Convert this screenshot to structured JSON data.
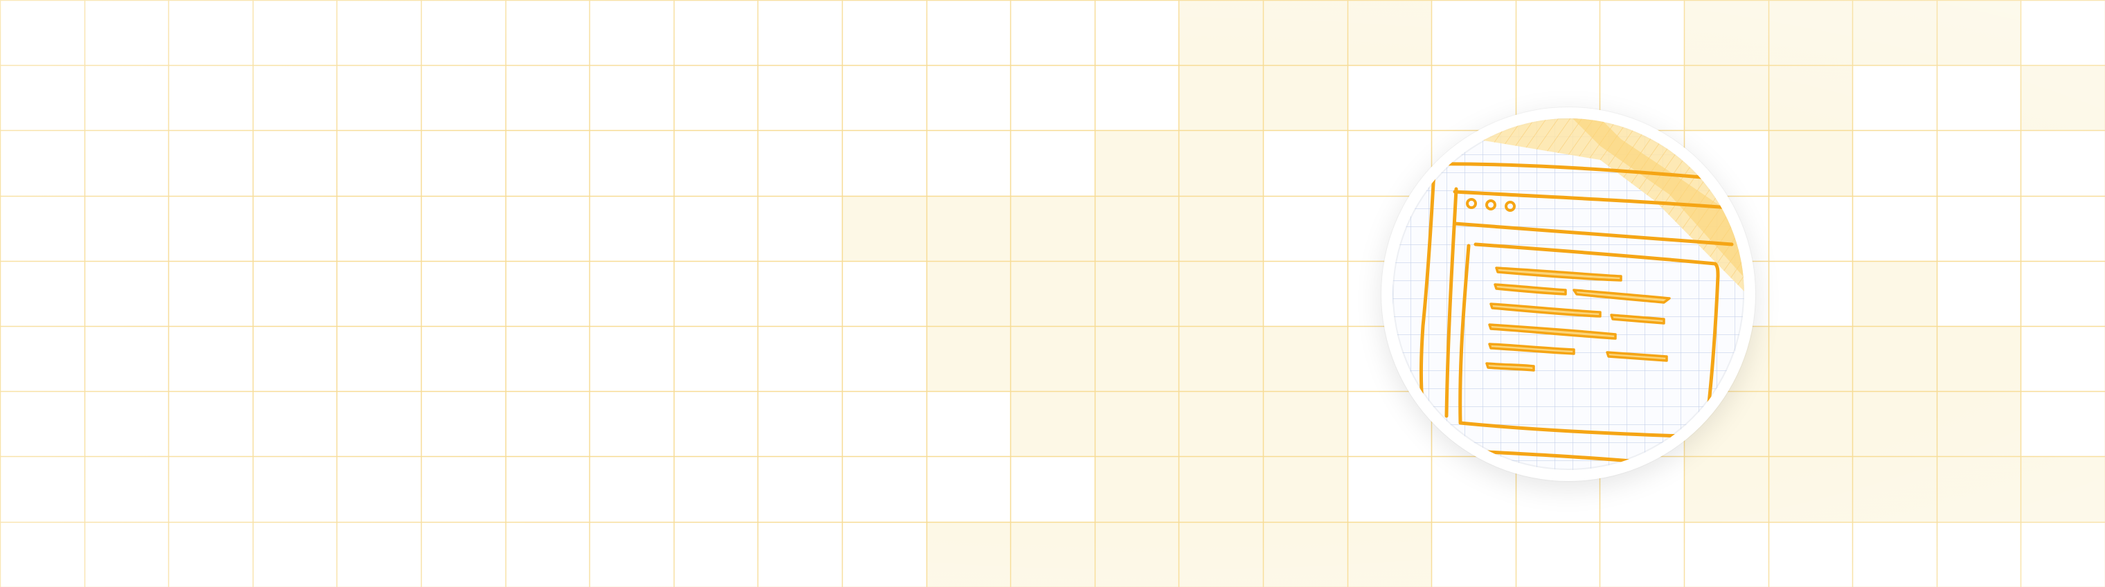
{
  "background": {
    "type": "grid",
    "line_color": "#f7dc95",
    "fill_color": "#fdf8e6",
    "highlighted_cells": [
      [
        14,
        0
      ],
      [
        15,
        0
      ],
      [
        16,
        0
      ],
      [
        20,
        0
      ],
      [
        21,
        0
      ],
      [
        22,
        0
      ],
      [
        23,
        0
      ],
      [
        14,
        1
      ],
      [
        15,
        1
      ],
      [
        20,
        1
      ],
      [
        21,
        1
      ],
      [
        24,
        1
      ],
      [
        13,
        2
      ],
      [
        14,
        2
      ],
      [
        21,
        2
      ],
      [
        10,
        3
      ],
      [
        11,
        3
      ],
      [
        12,
        3
      ],
      [
        13,
        3
      ],
      [
        14,
        3
      ],
      [
        11,
        4
      ],
      [
        12,
        4
      ],
      [
        13,
        4
      ],
      [
        14,
        4
      ],
      [
        22,
        4
      ],
      [
        11,
        5
      ],
      [
        12,
        5
      ],
      [
        13,
        5
      ],
      [
        14,
        5
      ],
      [
        15,
        5
      ],
      [
        20,
        5
      ],
      [
        21,
        5
      ],
      [
        22,
        5
      ],
      [
        23,
        5
      ],
      [
        12,
        6
      ],
      [
        13,
        6
      ],
      [
        14,
        6
      ],
      [
        15,
        6
      ],
      [
        20,
        6
      ],
      [
        21,
        6
      ],
      [
        22,
        6
      ],
      [
        23,
        6
      ],
      [
        13,
        7
      ],
      [
        14,
        7
      ],
      [
        15,
        7
      ],
      [
        20,
        7
      ],
      [
        21,
        7
      ],
      [
        22,
        7
      ],
      [
        23,
        7
      ],
      [
        24,
        7
      ],
      [
        11,
        8
      ],
      [
        12,
        8
      ],
      [
        13,
        8
      ],
      [
        14,
        8
      ],
      [
        15,
        8
      ],
      [
        16,
        8
      ]
    ]
  },
  "emblem": {
    "icon": "sketch-document-window-icon",
    "accent_color": "#f5a515",
    "accent_light": "#fde5a8",
    "grid_color": "#c5d1ea"
  }
}
